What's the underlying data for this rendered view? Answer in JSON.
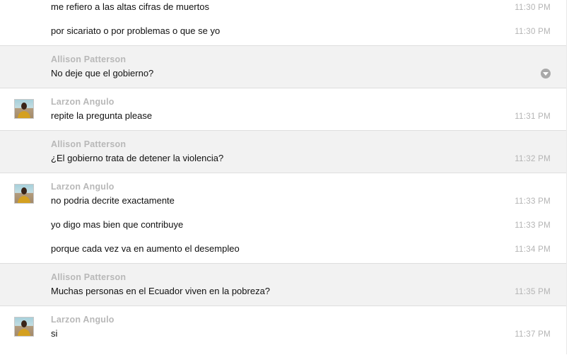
{
  "chat": {
    "blocks": [
      {
        "sender": "",
        "messages": [
          {
            "text": "me refiero a las altas cifras de muertos",
            "time": "11:30 PM"
          },
          {
            "text": "por sicariato o por problemas o que se yo",
            "time": "11:30 PM"
          }
        ]
      },
      {
        "sender": "Allison Patterson",
        "messages": [
          {
            "text": "No deje que el gobierno?",
            "time": ""
          }
        ]
      },
      {
        "sender": "Larzon Angulo",
        "messages": [
          {
            "text": "repite la pregunta please",
            "time": "11:31 PM"
          }
        ]
      },
      {
        "sender": "Allison Patterson",
        "messages": [
          {
            "text": "¿El gobierno trata de detener la violencia?",
            "time": "11:32 PM"
          }
        ]
      },
      {
        "sender": "Larzon Angulo",
        "messages": [
          {
            "text": "no podria decrite exactamente",
            "time": "11:33 PM"
          },
          {
            "text": "yo digo mas bien que contribuye",
            "time": "11:33 PM"
          },
          {
            "text": "porque cada vez va en aumento el desempleo",
            "time": "11:34 PM"
          }
        ]
      },
      {
        "sender": "Allison Patterson",
        "messages": [
          {
            "text": "Muchas personas en el Ecuador viven en la pobreza?",
            "time": "11:35 PM"
          }
        ]
      },
      {
        "sender": "Larzon Angulo",
        "messages": [
          {
            "text": "si",
            "time": "11:37 PM"
          }
        ]
      }
    ]
  },
  "icons": {
    "message_menu": "chevron-down-icon",
    "avatar": "user-avatar"
  }
}
